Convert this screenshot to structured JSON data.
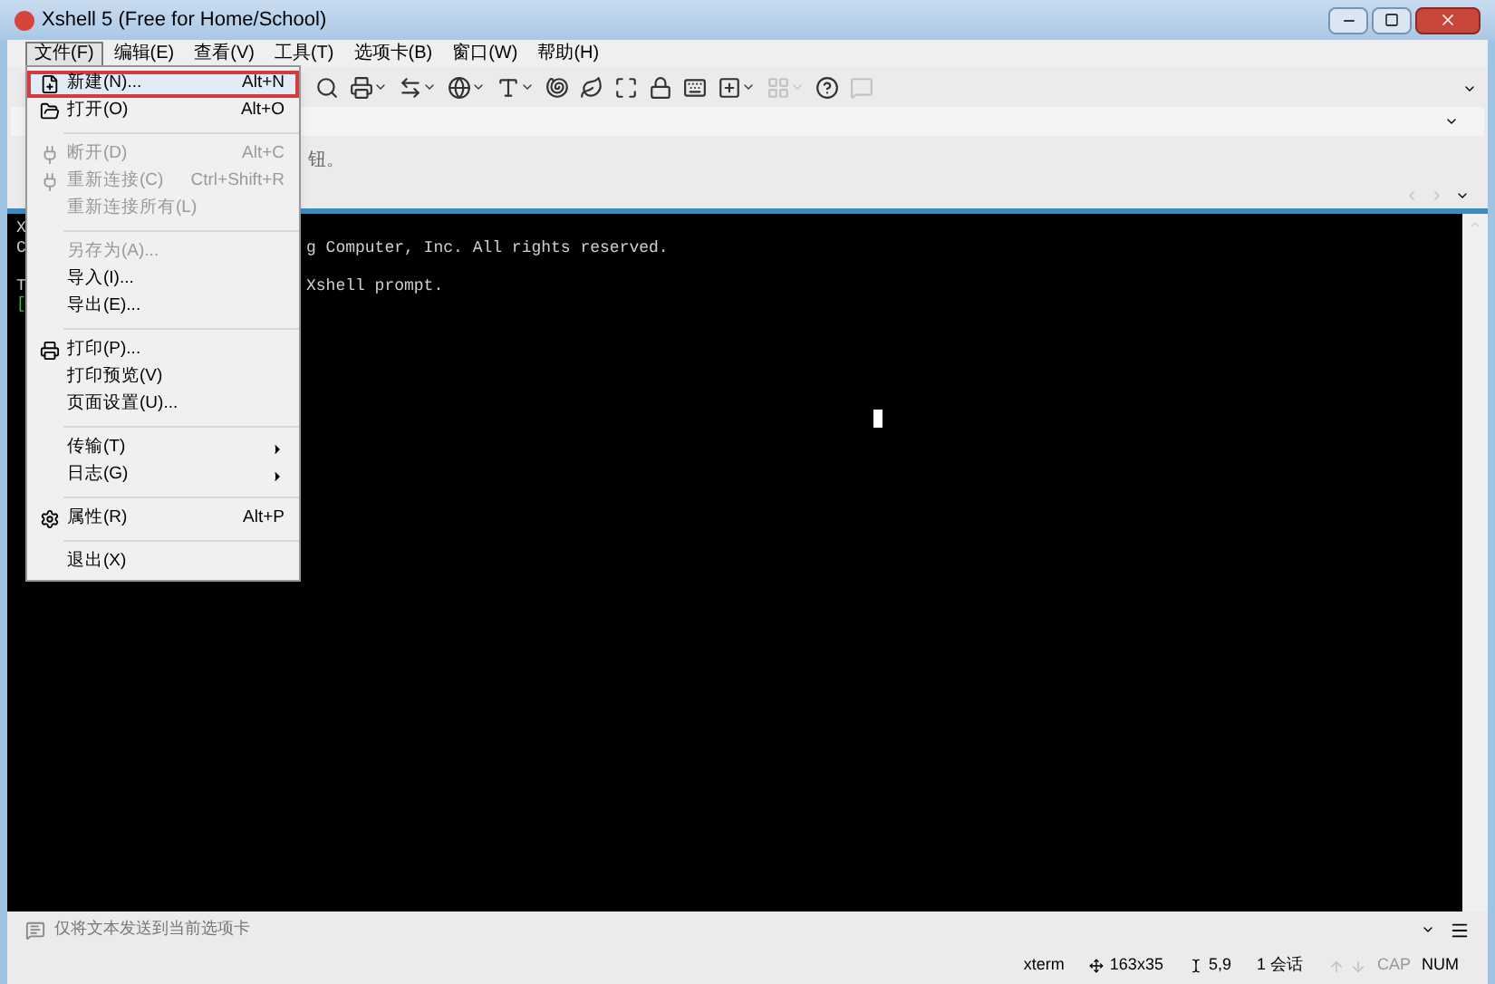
{
  "window": {
    "title": "Xshell 5 (Free for Home/School)"
  },
  "menubar": [
    {
      "label": "文件(F)",
      "selected": true
    },
    {
      "label": "编辑(E)",
      "selected": false
    },
    {
      "label": "查看(V)",
      "selected": false
    },
    {
      "label": "工具(T)",
      "selected": false
    },
    {
      "label": "选项卡(B)",
      "selected": false
    },
    {
      "label": "窗口(W)",
      "selected": false
    },
    {
      "label": "帮助(H)",
      "selected": false
    }
  ],
  "toolbar": [
    {
      "caret": false,
      "disabled": false
    },
    {
      "caret": true,
      "disabled": false
    },
    {
      "caret": true,
      "disabled": false
    },
    {
      "caret": true,
      "disabled": false
    },
    {
      "caret": true,
      "disabled": false
    },
    {
      "caret": false,
      "disabled": false
    },
    {
      "caret": false,
      "disabled": false
    },
    {
      "caret": false,
      "disabled": false
    },
    {
      "caret": false,
      "disabled": false
    },
    {
      "caret": false,
      "disabled": false
    },
    {
      "caret": true,
      "disabled": false
    },
    {
      "caret": true,
      "disabled": true
    },
    {
      "caret": false,
      "disabled": false
    },
    {
      "caret": false,
      "disabled": true
    }
  ],
  "info_bar": {
    "text": "钮。"
  },
  "terminal": {
    "lines": [
      {
        "left": "X"
      },
      {
        "left": "C",
        "right": "g Computer, Inc. All rights reserved."
      },
      {
        "left": "T",
        "right": "Xshell prompt.",
        "gap_before": true
      },
      {
        "left": "[",
        "prompt": true
      }
    ]
  },
  "file_menu": [
    {
      "kind": "item",
      "label": "新建(N)...",
      "shortcut": "Alt+N",
      "disabled": false,
      "selected": true,
      "submenu": false
    },
    {
      "kind": "item",
      "label": "打开(O)",
      "shortcut": "Alt+O",
      "disabled": false,
      "selected": false,
      "submenu": false
    },
    {
      "kind": "separator"
    },
    {
      "kind": "item",
      "label": "断开(D)",
      "shortcut": "Alt+C",
      "disabled": true,
      "selected": false,
      "submenu": false
    },
    {
      "kind": "item",
      "label": "重新连接(C)",
      "shortcut": "Ctrl+Shift+R",
      "disabled": true,
      "selected": false,
      "submenu": false
    },
    {
      "kind": "item",
      "label": "重新连接所有(L)",
      "disabled": true,
      "selected": false,
      "submenu": false
    },
    {
      "kind": "separator"
    },
    {
      "kind": "item",
      "label": "另存为(A)...",
      "disabled": true,
      "selected": false,
      "submenu": false
    },
    {
      "kind": "item",
      "label": "导入(I)...",
      "disabled": false,
      "selected": false,
      "submenu": false
    },
    {
      "kind": "item",
      "label": "导出(E)...",
      "disabled": false,
      "selected": false,
      "submenu": false
    },
    {
      "kind": "separator"
    },
    {
      "kind": "item",
      "label": "打印(P)...",
      "disabled": false,
      "selected": false,
      "submenu": false
    },
    {
      "kind": "item",
      "label": "打印预览(V)",
      "disabled": false,
      "selected": false,
      "submenu": false
    },
    {
      "kind": "item",
      "label": "页面设置(U)...",
      "disabled": false,
      "selected": false,
      "submenu": false
    },
    {
      "kind": "separator"
    },
    {
      "kind": "item",
      "label": "传输(T)",
      "disabled": false,
      "selected": false,
      "submenu": true
    },
    {
      "kind": "item",
      "label": "日志(G)",
      "disabled": false,
      "selected": false,
      "submenu": true
    },
    {
      "kind": "separator"
    },
    {
      "kind": "item",
      "label": "属性(R)",
      "shortcut": "Alt+P",
      "disabled": false,
      "selected": false,
      "submenu": false
    },
    {
      "kind": "separator"
    },
    {
      "kind": "item",
      "label": "退出(X)",
      "disabled": false,
      "selected": false,
      "submenu": false
    }
  ],
  "compose_bar": {
    "placeholder": "仅将文本发送到当前选项卡"
  },
  "status_bar": [
    {
      "kind": "text",
      "label": "xterm"
    },
    {
      "kind": "size",
      "label": "163x35"
    },
    {
      "kind": "cursor",
      "label": "5,9"
    },
    {
      "kind": "text",
      "label": "1 会话"
    },
    {
      "kind": "arrows",
      "disabled": true
    },
    {
      "kind": "lock",
      "label": "CAP",
      "on": false
    },
    {
      "kind": "lock",
      "label": "NUM",
      "on": true
    }
  ]
}
